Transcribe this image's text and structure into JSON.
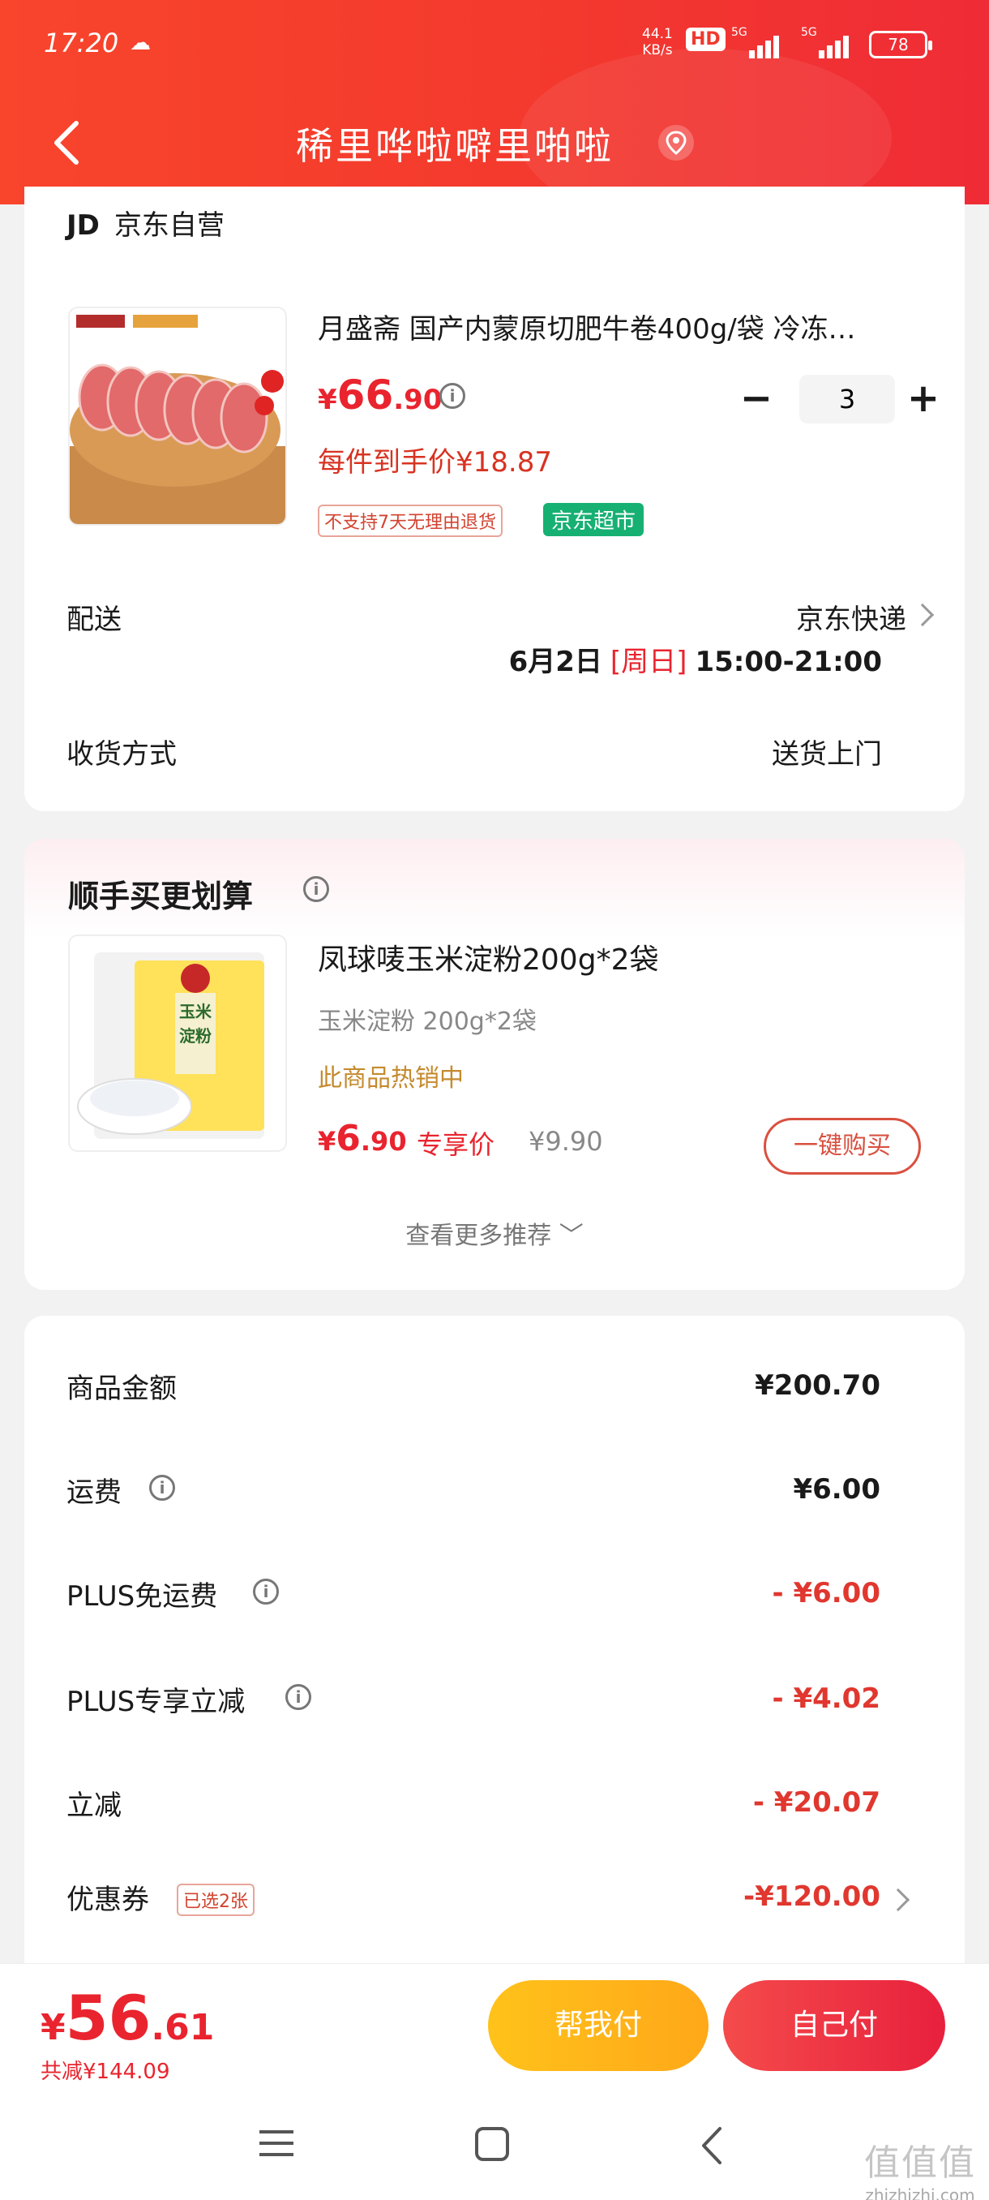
{
  "status_bar": {
    "time": "17:20",
    "speed_value": "44.1",
    "speed_unit": "KB/s",
    "hd": "HD",
    "signal1_label": "5G",
    "signal2_label": "5G",
    "battery": "78"
  },
  "nav": {
    "title": "稀里哗啦噼里啪啦"
  },
  "store": {
    "logo": "JD",
    "name": "京东自营"
  },
  "product": {
    "title": "月盛斋 国产内蒙原切肥牛卷400g/袋 冷冻…",
    "price_currency": "¥",
    "price_int": "66",
    "price_dec": ".90",
    "quantity": "3",
    "minus": "−",
    "plus": "+",
    "unit_price": "每件到手价¥18.87",
    "tag_no_return": "不支持7天无理由退货",
    "tag_store": "京东超市"
  },
  "delivery": {
    "label": "配送",
    "carrier": "京东快递",
    "date": "6月2日",
    "weekday": "[周日]",
    "time_window": "15:00-21:00",
    "receive_label": "收货方式",
    "receive_value": "送货上门"
  },
  "recommend": {
    "title": "顺手买更划算",
    "product_title": "凤球唛玉米淀粉200g*2袋",
    "spec": "玉米淀粉 200g*2袋",
    "hot": "此商品热销中",
    "price_currency": "¥",
    "price_int": "6",
    "price_dec": ".90",
    "exclusive_label": "专享价",
    "original_price": "¥9.90",
    "buy_button": "一键购买",
    "more": "查看更多推荐",
    "more_arrow": "﹀",
    "package_text": "玉米淀粉",
    "package_brand": "凤球唛"
  },
  "summary": {
    "rows": [
      {
        "label": "商品金额",
        "value": "¥200.70"
      },
      {
        "label": "运费",
        "value": "¥6.00"
      },
      {
        "label": "PLUS免运费",
        "value": "- ¥6.00"
      },
      {
        "label": "PLUS专享立减",
        "value": "- ¥4.02"
      },
      {
        "label": "立减",
        "value": "- ¥20.07"
      },
      {
        "label": "优惠券",
        "value": "-¥120.00",
        "tag": "已选2张"
      }
    ]
  },
  "bottom": {
    "currency": "¥",
    "total_int": "56",
    "total_dec": ".61",
    "saved": "共减¥144.09",
    "pay_friend": "帮我付",
    "pay_self": "自己付"
  },
  "watermark": {
    "big": "值值值",
    "small": "zhizhizhi.com"
  },
  "colors": {
    "brand_red": "#e9242e",
    "header_gradient_start": "#f8452c",
    "jd_supermarket_green": "#17b073",
    "pay_friend_yellow": "#ffc21a"
  }
}
